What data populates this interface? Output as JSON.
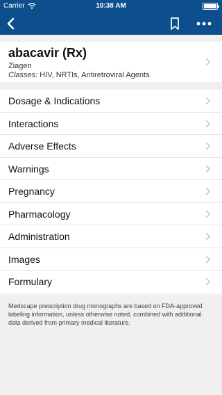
{
  "statusbar": {
    "carrier": "Carrier",
    "time": "10:38 AM"
  },
  "navbar": {
    "back_icon": "chevron-left-icon",
    "bookmark_icon": "bookmark-icon",
    "more_icon": "more-dots-icon"
  },
  "drug": {
    "name": "abacavir (Rx)",
    "brand": "Ziagen",
    "classes_label": "Classes:",
    "classes": "HIV, NRTIs, Antiretroviral Agents"
  },
  "menu": {
    "items": [
      {
        "label": "Dosage & Indications"
      },
      {
        "label": "Interactions"
      },
      {
        "label": "Adverse Effects"
      },
      {
        "label": "Warnings"
      },
      {
        "label": "Pregnancy"
      },
      {
        "label": "Pharmacology"
      },
      {
        "label": "Administration"
      },
      {
        "label": "Images"
      },
      {
        "label": "Formulary"
      }
    ]
  },
  "footer": {
    "note": "Medscape prescription drug monographs are based on FDA-approved labeling information, unless otherwise noted, combined with additional data derived from primary medical literature."
  },
  "colors": {
    "header_bg": "#0d4f8c",
    "page_bg": "#f0f0f0",
    "chevron": "#c2c2c2"
  }
}
